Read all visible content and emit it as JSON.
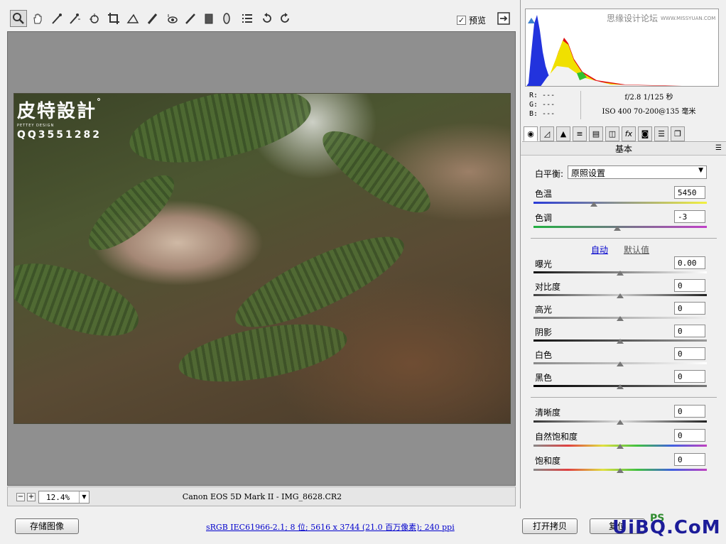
{
  "toolbar": {
    "tools": [
      "zoom-icon",
      "hand-icon",
      "white-balance-icon",
      "color-sampler-icon",
      "target-adjust-icon",
      "crop-icon",
      "straighten-icon",
      "spot-removal-icon",
      "red-eye-icon",
      "adjustment-brush-icon",
      "graduated-filter-icon",
      "radial-filter-icon",
      "preferences-icon",
      "rotate-left-icon",
      "rotate-right-icon"
    ],
    "preview_label": "预览",
    "preview_checked": "✓"
  },
  "watermark": {
    "brand": "皮特設計",
    "registered": "°",
    "sub": "PETTEY DESIGN",
    "qq": "QQ3551282"
  },
  "status": {
    "zoom_minus": "−",
    "zoom_plus": "+",
    "zoom": "12.4%",
    "file": "Canon EOS 5D Mark II -  IMG_8628.CR2"
  },
  "bottom": {
    "save_label": "存储图像",
    "info": "sRGB IEC61966-2.1; 8 位; 5616 x 3744 (21.0 百万像素); 240 ppi",
    "open_copy_label": "打开拷贝",
    "reset_label": "复位"
  },
  "logo": {
    "text": "UiBQ.CoM",
    "ps": "PS"
  },
  "histogram": {
    "watermark": "思缘设计论坛",
    "watermark_url": "WWW.MISSYUAN.COM",
    "accent": "#3a7fd0"
  },
  "meta": {
    "r": "R:  ---",
    "g": "G:  ---",
    "b": "B:  ---",
    "exposure": "f/2.8   1/125 秒",
    "lens": "ISO 400   70-200@135 毫米"
  },
  "panel": {
    "title": "基本",
    "menu": "☰",
    "wb_label": "白平衡:",
    "wb_value": "原照设置",
    "temp_label": "色温",
    "temp_value": "5450",
    "tint_label": "色调",
    "tint_value": "-3",
    "auto": "自动",
    "default": "默认值",
    "exposure_label": "曝光",
    "exposure_value": "0.00",
    "contrast_label": "对比度",
    "contrast_value": "0",
    "highlights_label": "高光",
    "highlights_value": "0",
    "shadows_label": "阴影",
    "shadows_value": "0",
    "whites_label": "白色",
    "whites_value": "0",
    "blacks_label": "黑色",
    "blacks_value": "0",
    "clarity_label": "清晰度",
    "clarity_value": "0",
    "vibrance_label": "自然饱和度",
    "vibrance_value": "0",
    "saturation_label": "饱和度",
    "saturation_value": "0"
  }
}
